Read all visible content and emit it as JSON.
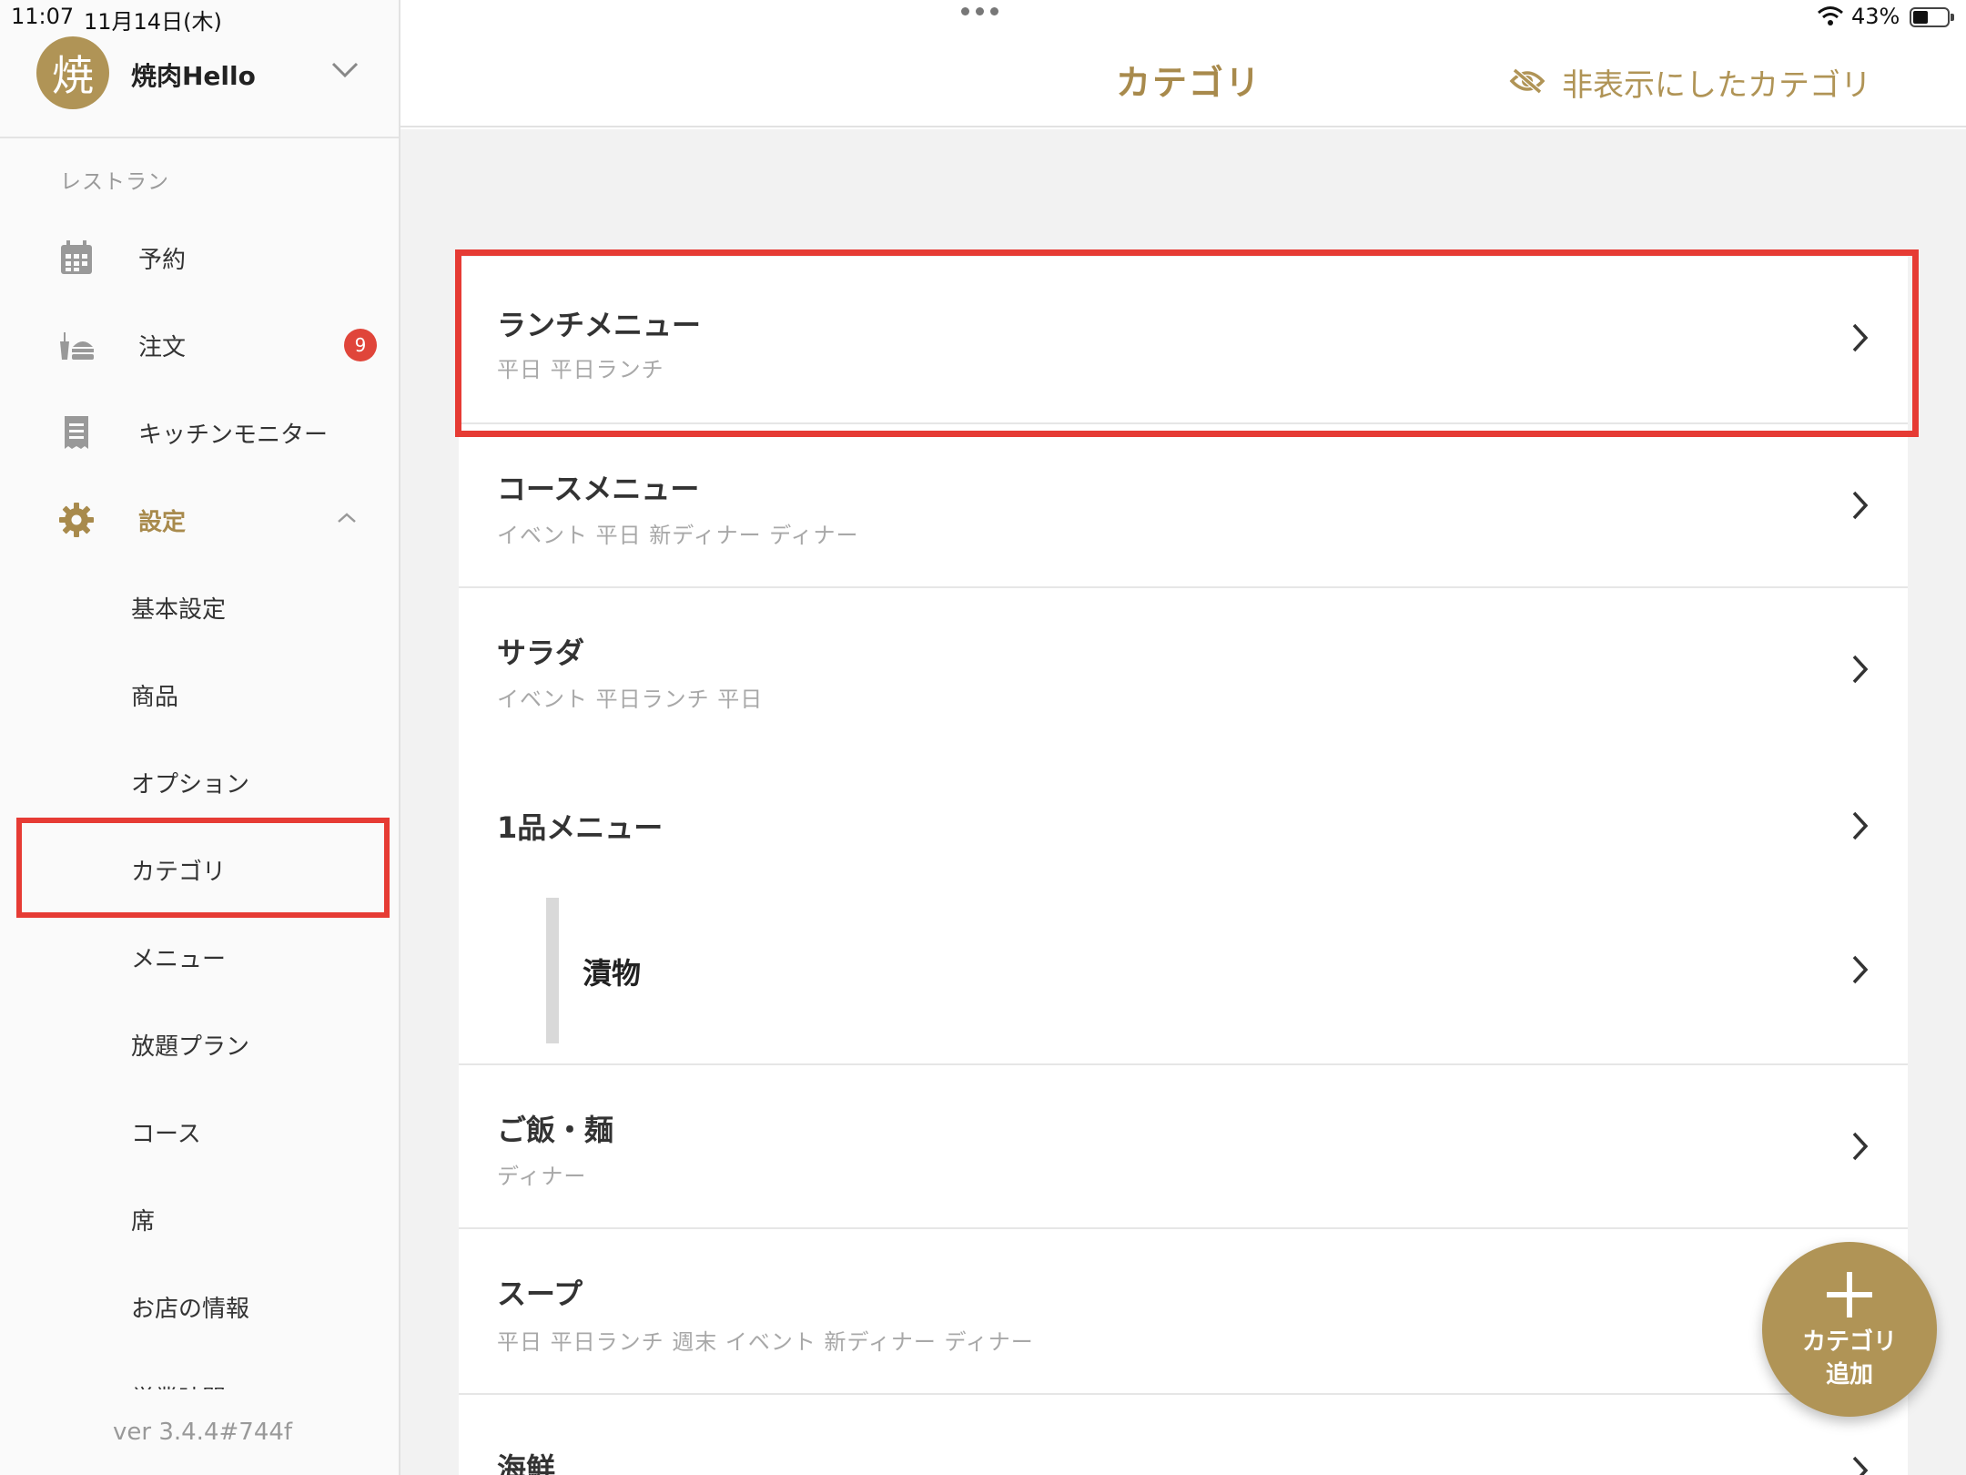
{
  "status_bar": {
    "time": "11:07",
    "date": "11月14日(木)",
    "battery": "43%"
  },
  "account": {
    "avatar_char": "焼",
    "name": "焼肉Hello"
  },
  "sidebar": {
    "section_label": "レストラン",
    "items": [
      {
        "label": "予約",
        "icon": "calendar-icon"
      },
      {
        "label": "注文",
        "icon": "food-tray-icon",
        "badge": "9"
      },
      {
        "label": "キッチンモニター",
        "icon": "receipt-icon"
      },
      {
        "label": "設定",
        "icon": "gear-icon",
        "active": true
      }
    ],
    "sub_items": [
      {
        "label": "基本設定"
      },
      {
        "label": "商品"
      },
      {
        "label": "オプション"
      },
      {
        "label": "カテゴリ",
        "selected": true
      },
      {
        "label": "メニュー"
      },
      {
        "label": "放題プラン"
      },
      {
        "label": "コース"
      },
      {
        "label": "席"
      },
      {
        "label": "お店の情報"
      },
      {
        "label": "営業時間"
      }
    ],
    "version": "ver 3.4.4#744f"
  },
  "header": {
    "title": "カテゴリ",
    "hidden_link": "非表示にしたカテゴリ"
  },
  "categories": [
    {
      "name": "ランチメニュー",
      "tags": "平日 平日ランチ"
    },
    {
      "name": "コースメニュー",
      "tags": "イベント 平日 新ディナー ディナー"
    },
    {
      "name": "サラダ",
      "tags": "イベント 平日ランチ 平日"
    },
    {
      "name": "1品メニュー",
      "tags": "",
      "children": [
        {
          "name": "漬物"
        }
      ]
    },
    {
      "name": "ご飯・麺",
      "tags": "ディナー"
    },
    {
      "name": "スープ",
      "tags": "平日 平日ランチ 週末 イベント 新ディナー ディナー"
    },
    {
      "name": "海鮮",
      "tags": ""
    }
  ],
  "fab": {
    "line1": "カテゴリ",
    "line2": "追加"
  },
  "colors": {
    "accent": "#b09456",
    "highlight": "#e63b34",
    "badge": "#e0453a"
  }
}
